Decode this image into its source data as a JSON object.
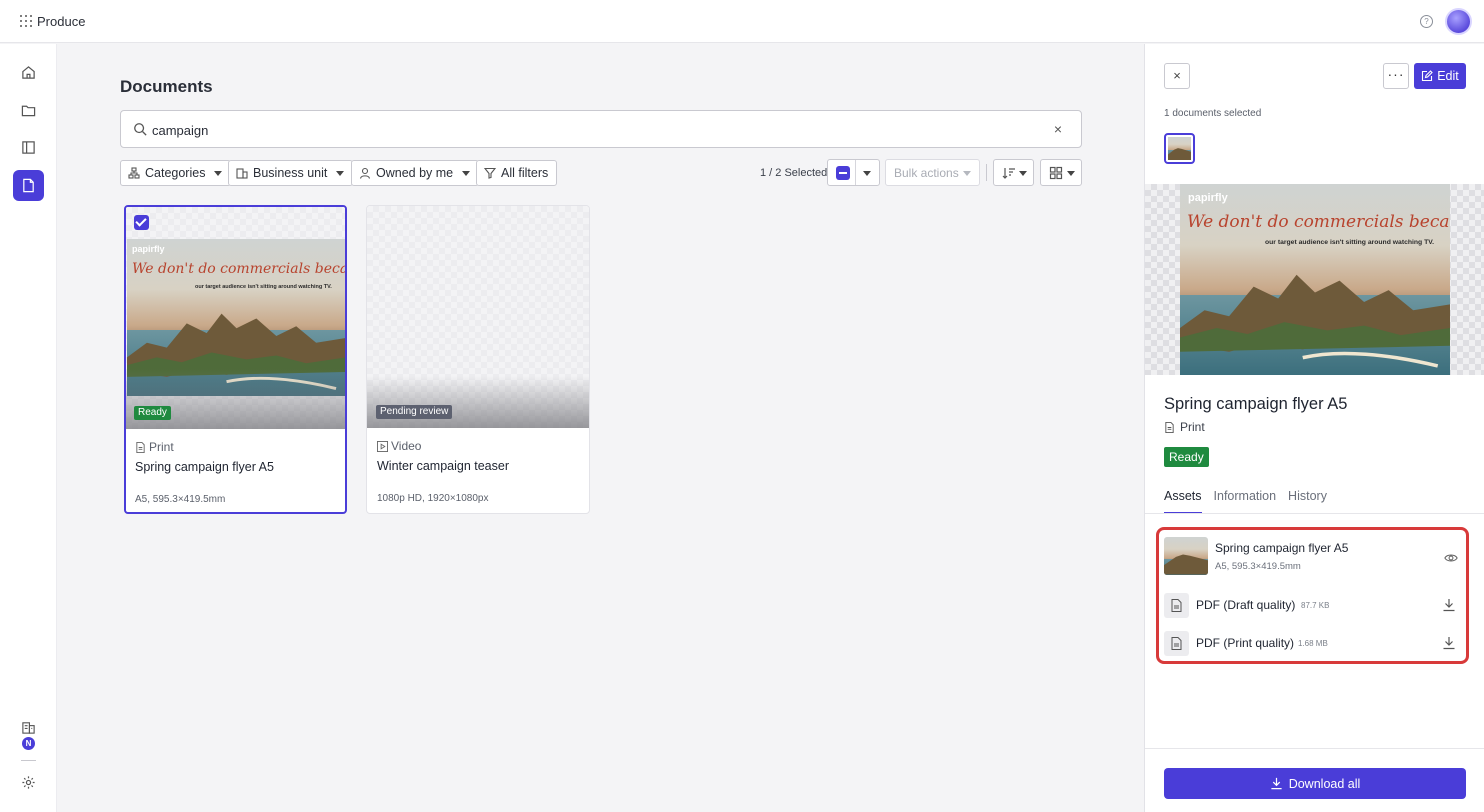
{
  "app": {
    "name": "Produce"
  },
  "main": {
    "title": "Documents",
    "search": {
      "value": "campaign",
      "placeholder": ""
    },
    "filters": [
      "Categories",
      "Business unit",
      "Owned by me",
      "All filters"
    ],
    "selection_count": "1 / 2 Selected",
    "bulk_actions_label": "Bulk actions"
  },
  "cards": [
    {
      "type": "Print",
      "title": "Spring campaign flyer A5",
      "meta": "A5, 595.3×419.5mm",
      "status": "Ready",
      "selected": true
    },
    {
      "type": "Video",
      "title": "Winter campaign teaser",
      "meta": "1080p HD, 1920×1080px",
      "status": "Pending review",
      "selected": false
    }
  ],
  "flyer": {
    "brand": "papirfly",
    "headline": "We don't do commercials because...",
    "subline": "our target audience isn't sitting around watching TV."
  },
  "panel": {
    "close_label": "×",
    "more_label": "···",
    "edit_label": "Edit",
    "selected_count": "1 documents selected",
    "title": "Spring campaign flyer A5",
    "type": "Print",
    "status": "Ready",
    "tabs": [
      "Assets",
      "Information",
      "History"
    ],
    "assets": {
      "main": {
        "name": "Spring campaign flyer A5",
        "meta": "A5, 595.3×419.5mm"
      },
      "files": [
        {
          "name": "PDF (Draft quality)",
          "size": "87.7 KB"
        },
        {
          "name": "PDF (Print quality)",
          "size": "1.68 MB"
        }
      ]
    },
    "download_all_label": "Download all"
  },
  "colors": {
    "accent": "#4a3dd8",
    "ready": "#1f8a3f",
    "pending": "#5d6170",
    "highlight": "#d83a3a"
  }
}
